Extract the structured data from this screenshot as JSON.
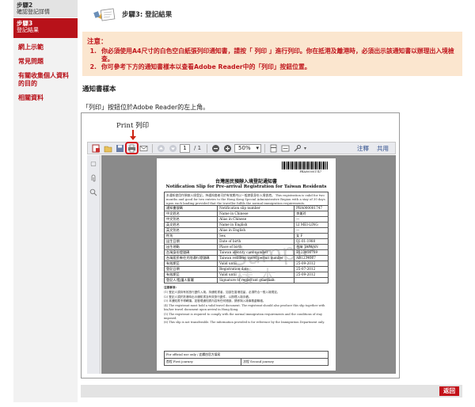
{
  "sidebar": {
    "steps": [
      {
        "title": "步驟2",
        "subtitle": "確認登記詳情"
      },
      {
        "title": "步驟3",
        "subtitle": "登記結果"
      }
    ],
    "links": [
      "網上示範",
      "常見問題",
      "有關收集個人資料的目的",
      "相關資料"
    ]
  },
  "header": {
    "title": "步驟3: 登記結果"
  },
  "notice": {
    "title": "注意：",
    "items": [
      {
        "num": "1.",
        "text": "你必須使用A4尺寸的白色空白紙張列印通知書，請按「  列印  」進行列印。你在抵港及離港時，必須出示該通知書以辦理出入境檢查。"
      },
      {
        "num": "2.",
        "text": "你可參考下方的通知書樣本以查看Adobe Reader中的「列印」按鈕位置。"
      }
    ]
  },
  "sample": {
    "heading": "通知書樣本",
    "desc": "「列印」按鈕位於Adobe Reader的左上角。",
    "caption": "Print 列印"
  },
  "viewer": {
    "page_current": "1",
    "page_total": "/ 1",
    "zoom": "50%",
    "tools": [
      "注釋",
      "共用"
    ]
  },
  "document": {
    "barcode_number": "PRA000001747",
    "title_cn": "台灣居民預辦入境登記通知書",
    "title_en": "Notification Slip for Pre-arrival Registration for Taiwan Residents",
    "intro": "本通知書用作預辦入境登記，持通知書者可於有效期內以一般旅客身份入境香港。 This registration is valid for two months and good for two entries to the Hong Kong Special Administrative Region with a stay of 30 days upon each landing provided that the traveller fulfils the normal immigration requirements.",
    "rows": [
      {
        "cn": "通知書號碼",
        "en": "Notification slip number",
        "val": "PRA000001747"
      },
      {
        "cn": "中文姓名",
        "en": "Name in Chinese",
        "val": "李美玲"
      },
      {
        "cn": "中文別名",
        "en": "Alias in Chinese",
        "val": "—"
      },
      {
        "cn": "英文姓名",
        "en": "Name in English",
        "val": "LI MEI-LING"
      },
      {
        "cn": "英文別名",
        "en": "Alias in English",
        "val": "—"
      },
      {
        "cn": "性別",
        "en": "Sex",
        "val": "女 F"
      },
      {
        "cn": "出生日期",
        "en": "Date of birth",
        "val": "01-01-1980"
      },
      {
        "cn": "出生地點",
        "en": "Place of birth",
        "val": "台灣 TAIWAN"
      },
      {
        "cn": "台灣身份證號碼",
        "en": "Taiwan identity card number",
        "val": "B123456789"
      },
      {
        "cn": "台灣居民來往大陸通行證號碼",
        "en": "Taiwan resident travel permit number",
        "val": "AB1234567"
      },
      {
        "cn": "有效期至",
        "en": "Valid until",
        "val": "25-09-2012"
      },
      {
        "cn": "登記日期",
        "en": "Registration date",
        "val": "25-07-2012"
      },
      {
        "cn": "有效期至",
        "en": "Valid until",
        "val": "25-09-2012"
      }
    ],
    "signature": {
      "cn": "登記人/監護人簽署",
      "en": "Signature of registrant guardian"
    },
    "notes_title": "注意事項：",
    "notes": [
      "(1) 登記人須持有效旅行證件入境。持通知書者，如欲在香港逗留，必須符合一般入境規定。",
      "(2) 登記人須於抵港時出示通知書及有效旅行證件，以辦理入境手續。",
      "(3) 本通知書不得轉讓。如發現通知書內容有任何錯誤，請即與入境事務處聯絡。",
      "(4) The registrant must hold a valid travel document. The registrant should also produce this slip together with his/her travel document upon arrival in Hong Kong.",
      "(5) The registrant is required to comply with the normal immigration requirements and the conditions of stay imposed.",
      "(6) This slip is not transferable. The information provided is for reference by the Immigration Department only."
    ],
    "official_use": "For official use only / 此欄由官方填寫",
    "first_journey": "首程 First journey",
    "second_journey": "次程 Second journey",
    "watermark_en": "Sample",
    "watermark_cn": "樣 本"
  },
  "footer": {
    "back_label": "返回"
  }
}
